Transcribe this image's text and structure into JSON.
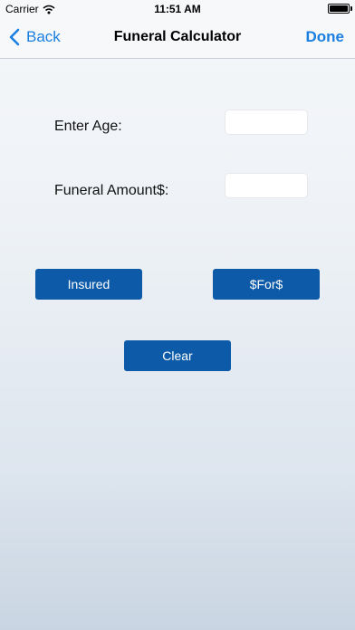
{
  "status_bar": {
    "carrier": "Carrier",
    "time": "11:51 AM"
  },
  "nav": {
    "back_label": "Back",
    "title": "Funeral Calculator",
    "done_label": "Done"
  },
  "form": {
    "age_label": "Enter Age:",
    "age_value": "",
    "amount_label": "Funeral Amount$:",
    "amount_value": ""
  },
  "buttons": {
    "insured": "Insured",
    "for": "$For$",
    "clear": "Clear"
  },
  "colors": {
    "accent": "#1a7fe0",
    "button": "#0c5aa8"
  }
}
